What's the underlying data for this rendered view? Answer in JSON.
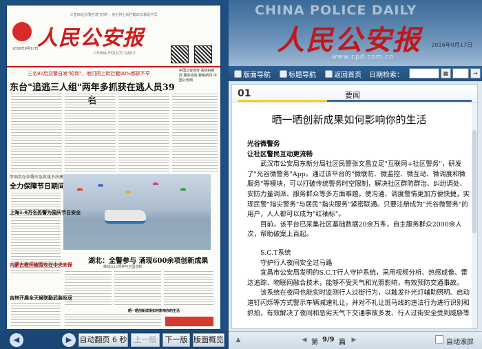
{
  "newspaper": {
    "masthead": "人民公安报",
    "masthead_en": "CHINA POLICE DAILY",
    "issue_date": "2016年9月17日",
    "topline": "三亚80后交警自发\"轮岗\"，他们将上街拦截90%都是不早",
    "deck": "三名80后交警自发\"轮岗\"，他们把上街拦截90%都抓不早",
    "headline": "东台\"追逃三人组\"两年多抓获在逃人员39名",
    "side_box": "中国公安宣传 系统好新闻 服务高效 聚焦新闻 中国公安网",
    "sub_headline_1": "全力保障节日期间平安祥和",
    "sub_headline_1_deck": "李国英在部署应急救援系统建设中强调",
    "sub_headline_2": "湖北：全警参与 涌现600余项创新成果",
    "sub_headline_2_deck": "推动以12项参与全国创新",
    "left_short_1": "上海1.6万名民警为国庆节日安全",
    "left_short_2": "内蒙古教师被围攻在中央安保",
    "left_short_3": "吉林开展全天候联勤武装巡逻",
    "bottom_article": "晒一晒创新成果如何影响你的生活"
  },
  "left_controls": {
    "auto_flip_label": "自动翻页",
    "auto_flip_seconds": "6 秒",
    "prev_page": "上一版",
    "next_page": "下一版",
    "overview": "版面概览"
  },
  "header": {
    "en_title": "CHINA POLICE DAILY",
    "cn_title": "人民公安报",
    "date": "2016年9月17日",
    "url": "www.cpd.com.cn"
  },
  "toolbar": {
    "items": [
      "版面导航",
      "标题导航",
      "返回首页",
      "日期检索："
    ],
    "date_value": "",
    "go_label": "→"
  },
  "article": {
    "page_no": "01",
    "page_name": "要闻",
    "title": "晒一晒创新成果如何影响你的生活",
    "section1_title": "光谷微警务",
    "section1_subtitle": "让社区警民互动更流畅",
    "para1": "武汉市公安局东新分局社区民警张文昌立足\"互联网+社区警务\"，研发了\"光谷微警务\"App。通过该平台的\"微联防、微监控、微互动、微调度和微服务\"等模块，可以打破传统警务时空限制，解决社区群防群治、纠纷调处、安防力量调派、服务群众等多方面难题，使沟通、调度警情更加方便快捷，实现民警\"指尖警务\"与居民\"指尖服务\"紧密联通。只要注册成为\"光谷微警务\"的用户，人人都可以成为\"红袖标\"。",
    "para2": "目前，该平台已采集社区基础数据20余万条，自主服务群众2000余人次，帮助破案上百起。",
    "section2_title": "S.C.T系统",
    "section2_subtitle": "守护行人夜间安全过马路",
    "para3": "宜昌市公安局发明的S.C.T行人守护系统，采用视频分析、热感成像、雷达追踪、物联网融合技术，能够不受天气和光照影响，有效预防交通事故。",
    "para4": "该系统在夜间也能实时监测行人过街行为，以触发扑光灯辅助照明、启动道钉闪烁等方式警示车辆减速礼让，并对不礼让斑马线的违法行为进行识别和抓拍，有效解决了夜间和恶劣天气下交通事故多发、行人过街安全受到威胁等"
  },
  "right_controls": {
    "page_label": "第",
    "page_value": "9/9",
    "page_suffix": "篇",
    "auto_scroll": "自动滚屏"
  }
}
